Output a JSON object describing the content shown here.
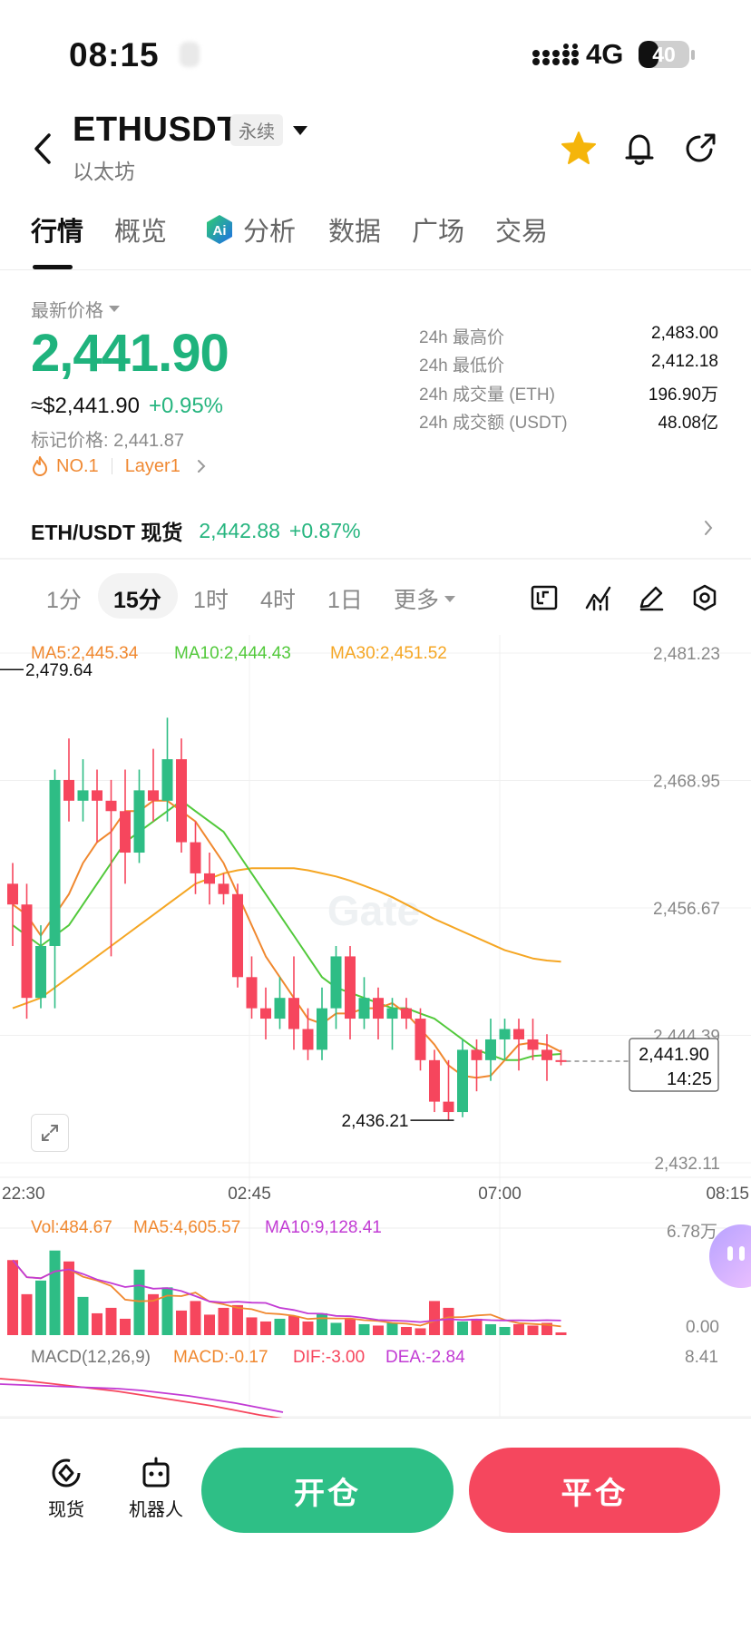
{
  "status_bar": {
    "time": "08:15",
    "network": "4G",
    "battery_text": "40",
    "battery_level_pct": 40
  },
  "header": {
    "pair": "ETHUSDT",
    "badge": "永续",
    "name": "以太坊"
  },
  "icons": {
    "back": "back-arrow-icon",
    "favorite": "star-icon",
    "alert": "bell-icon",
    "share": "share-icon",
    "ai": "ai-icon",
    "fullscreen": "expand-icon"
  },
  "tabs": [
    {
      "label": "行情",
      "active": true
    },
    {
      "label": "概览",
      "active": false
    },
    {
      "label": "分析",
      "active": false,
      "icon": "ai-icon"
    },
    {
      "label": "数据",
      "active": false
    },
    {
      "label": "广场",
      "active": false
    },
    {
      "label": "交易",
      "active": false
    }
  ],
  "ticker": {
    "price_label": "最新价格",
    "last_price": "2,441.90",
    "usd_price": "≈$2,441.90",
    "change": "+0.95%",
    "mark_price": "标记价格: 2,441.87",
    "rank_tag": "NO.1",
    "category_tag": "Layer1",
    "stats": [
      {
        "label": "24h 最高价",
        "value": "2,483.00"
      },
      {
        "label": "24h 最低价",
        "value": "2,412.18"
      },
      {
        "label": "24h 成交量 (ETH)",
        "value": "196.90万"
      },
      {
        "label": "24h 成交额 (USDT)",
        "value": "48.08亿"
      }
    ]
  },
  "spot": {
    "label": "ETH/USDT 现货",
    "price": "2,442.88",
    "change": "+0.87%"
  },
  "intervals": [
    "1分",
    "15分",
    "1时",
    "4时",
    "1日",
    "更多"
  ],
  "selected_interval": "15分",
  "colors": {
    "up": "#2ebd85",
    "down": "#f6465d",
    "ma5": "#f0882f",
    "ma10": "#52c93b",
    "ma30": "#f5a623",
    "vol_ma10": "#c23bd4"
  },
  "chart_data": {
    "type": "candlestick",
    "indicators": {
      "ma5": "MA5:2,445.34",
      "ma10": "MA10:2,444.43",
      "ma30": "MA30:2,451.52"
    },
    "y_ticks": [
      "2,481.23",
      "2,468.95",
      "2,456.67",
      "2,444.39",
      "2,432.11"
    ],
    "ylim": [
      2432.11,
      2481.23
    ],
    "x_ticks": [
      "22:30",
      "02:45",
      "07:00",
      "08:15"
    ],
    "high_marker": "2,479.64",
    "low_marker": "2,436.21",
    "last_price": "2,441.90",
    "countdown": "14:25",
    "ohlc": [
      [
        2459,
        2461,
        2453,
        2457
      ],
      [
        2457,
        2459,
        2446,
        2448
      ],
      [
        2448,
        2455,
        2447,
        2453
      ],
      [
        2453,
        2470,
        2447,
        2469
      ],
      [
        2469,
        2473,
        2465,
        2467
      ],
      [
        2467,
        2471,
        2465,
        2468
      ],
      [
        2468,
        2470,
        2463,
        2467
      ],
      [
        2467,
        2469,
        2452,
        2466
      ],
      [
        2466,
        2470,
        2459,
        2462
      ],
      [
        2462,
        2470,
        2461,
        2468
      ],
      [
        2468,
        2472,
        2465,
        2467
      ],
      [
        2467,
        2475,
        2465,
        2471
      ],
      [
        2471,
        2473,
        2462,
        2463
      ],
      [
        2463,
        2465,
        2458,
        2460
      ],
      [
        2460,
        2462,
        2457,
        2459
      ],
      [
        2459,
        2460,
        2457,
        2458
      ],
      [
        2458,
        2459,
        2449,
        2450
      ],
      [
        2450,
        2452,
        2446,
        2447
      ],
      [
        2447,
        2449,
        2444,
        2446
      ],
      [
        2446,
        2450,
        2445,
        2448
      ],
      [
        2448,
        2452,
        2443,
        2445
      ],
      [
        2445,
        2447,
        2442,
        2443
      ],
      [
        2443,
        2449,
        2442,
        2447
      ],
      [
        2447,
        2453,
        2445,
        2452
      ],
      [
        2452,
        2453,
        2444,
        2446
      ],
      [
        2446,
        2450,
        2445,
        2448
      ],
      [
        2448,
        2449,
        2444,
        2446
      ],
      [
        2446,
        2448,
        2443,
        2447
      ],
      [
        2447,
        2448,
        2445,
        2446
      ],
      [
        2446,
        2447,
        2441,
        2442
      ],
      [
        2442,
        2443,
        2437,
        2438
      ],
      [
        2438,
        2442,
        2436.2,
        2437
      ],
      [
        2437,
        2444,
        2436.5,
        2443
      ],
      [
        2443,
        2444,
        2439,
        2442
      ],
      [
        2442,
        2446,
        2440,
        2444
      ],
      [
        2444,
        2446,
        2442,
        2445
      ],
      [
        2445,
        2446,
        2441,
        2444
      ],
      [
        2444,
        2446,
        2442,
        2443
      ],
      [
        2443,
        2444.5,
        2440,
        2442
      ],
      [
        2442,
        2443,
        2441.5,
        2441.9
      ]
    ],
    "ma5_line": [
      2457,
      2456,
      2454,
      2456,
      2458,
      2461,
      2463,
      2464,
      2466,
      2466,
      2467,
      2467,
      2466,
      2465,
      2463,
      2461,
      2458,
      2455,
      2452,
      2450,
      2448,
      2446,
      2445.5,
      2446.5,
      2446.5,
      2447,
      2447,
      2447.5,
      2446.5,
      2445,
      2443.5,
      2441.5,
      2440.5,
      2440.3,
      2440.5,
      2442,
      2443.5,
      2443.7,
      2443.5,
      2442.8
    ],
    "ma10_line": [
      2455,
      2454,
      2453,
      2454,
      2455,
      2457,
      2459,
      2461,
      2463,
      2464,
      2465,
      2466,
      2467,
      2466,
      2465,
      2464,
      2462,
      2460,
      2458,
      2456,
      2454,
      2452,
      2450,
      2449,
      2448.5,
      2448,
      2447.5,
      2447,
      2447,
      2446.5,
      2446,
      2445,
      2444,
      2443,
      2442.5,
      2442,
      2442,
      2442.4,
      2442.5,
      2442.6
    ],
    "ma30_line": [
      2447,
      2447.5,
      2448,
      2449,
      2450,
      2451,
      2452,
      2453,
      2454,
      2455,
      2456,
      2457,
      2458,
      2459,
      2459.5,
      2460,
      2460.3,
      2460.5,
      2460.5,
      2460.5,
      2460.5,
      2460.3,
      2460,
      2459.7,
      2459.3,
      2458.8,
      2458.3,
      2457.7,
      2457,
      2456.3,
      2455.6,
      2455,
      2454.4,
      2453.8,
      2453.2,
      2452.6,
      2452.2,
      2451.8,
      2451.6,
      2451.5
    ],
    "volume": {
      "labels": {
        "vol": "Vol:484.67",
        "ma5": "MA5:4,605.57",
        "ma10": "MA10:9,128.41"
      },
      "max_label": "6.78万",
      "min_label": "0.00",
      "values": [
        55000,
        30000,
        40000,
        62000,
        54000,
        28000,
        16000,
        20000,
        12000,
        48000,
        30000,
        35000,
        18000,
        25000,
        15000,
        20000,
        22000,
        13000,
        10000,
        12000,
        14000,
        10000,
        16000,
        9000,
        12000,
        8000,
        7000,
        9000,
        6000,
        5000,
        25000,
        20000,
        10000,
        12000,
        8000,
        6000,
        8000,
        7000,
        9000,
        2000
      ]
    },
    "macd": {
      "label": "MACD(12,26,9)",
      "macd": "MACD:-0.17",
      "dif": "DIF:-3.00",
      "dea": "DEA:-2.84",
      "max_label": "8.41"
    }
  },
  "bottom_bar": {
    "spot_label": "现货",
    "bot_label": "机器人",
    "open_label": "开仓",
    "close_label": "平仓"
  }
}
